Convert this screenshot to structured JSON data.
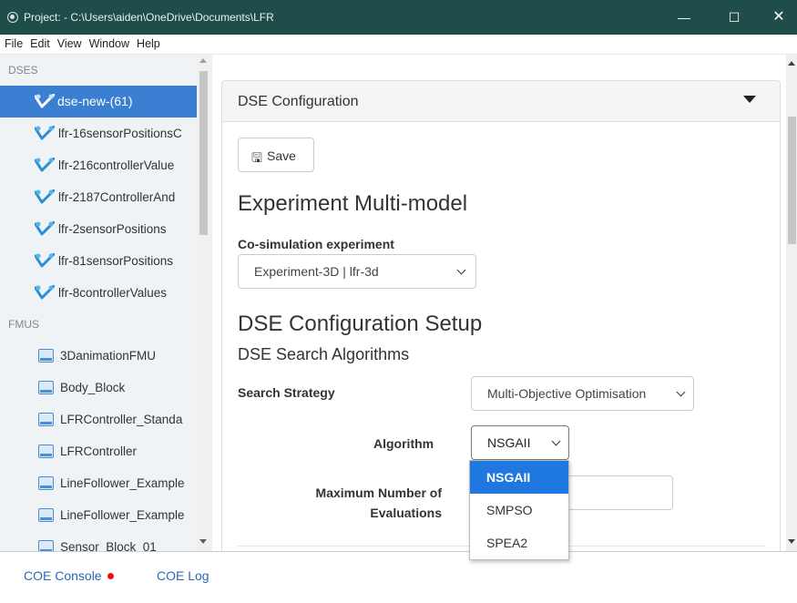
{
  "window": {
    "title": "Project: - C:\\Users\\aiden\\OneDrive\\Documents\\LFR",
    "minimize_glyph": "—",
    "maximize_glyph": "☐",
    "close_glyph": "✕"
  },
  "menu": [
    "File",
    "Edit",
    "View",
    "Window",
    "Help"
  ],
  "sidebar": {
    "dses_header": "DSES",
    "dses": [
      "dse-new-(61)",
      "lfr-16sensorPositionsC",
      "lfr-216controllerValue",
      "lfr-2187ControllerAnd",
      "lfr-2sensorPositions",
      "lfr-81sensorPositions",
      "lfr-8controllerValues"
    ],
    "fmus_header": "FMUS",
    "fmus": [
      "3DanimationFMU",
      "Body_Block",
      "LFRController_Standa",
      "LFRController",
      "LineFollower_Example",
      "LineFollower_Example",
      "Sensor_Block_01"
    ],
    "active_index": 0
  },
  "panel": {
    "title": "DSE Configuration",
    "save_label": "Save",
    "experiment_heading": "Experiment Multi-model",
    "cosim_label": "Co-simulation experiment",
    "cosim_value": "Experiment-3D | lfr-3d",
    "setup_heading": "DSE Configuration Setup",
    "search_heading": "DSE Search Algorithms",
    "strategy_label": "Search Strategy",
    "strategy_value": "Multi-Objective Optimisation",
    "algorithm_label": "Algorithm",
    "algorithm_value": "NSGAII",
    "maxeval_label_1": "Maximum Number of",
    "maxeval_label_2": "Evaluations",
    "maxeval_value": ""
  },
  "algorithm_options": [
    "NSGAII",
    "SMPSO",
    "SPEA2"
  ],
  "algorithm_selected_index": 0,
  "bottom": {
    "console_label": "COE Console",
    "log_label": "COE Log"
  },
  "colors": {
    "titlebar": "#1f4e4a",
    "active_item": "#3a7fd1",
    "dropdown_selected": "#1e78e0",
    "link": "#2d6ab5",
    "status_dot": "#ee1111"
  }
}
